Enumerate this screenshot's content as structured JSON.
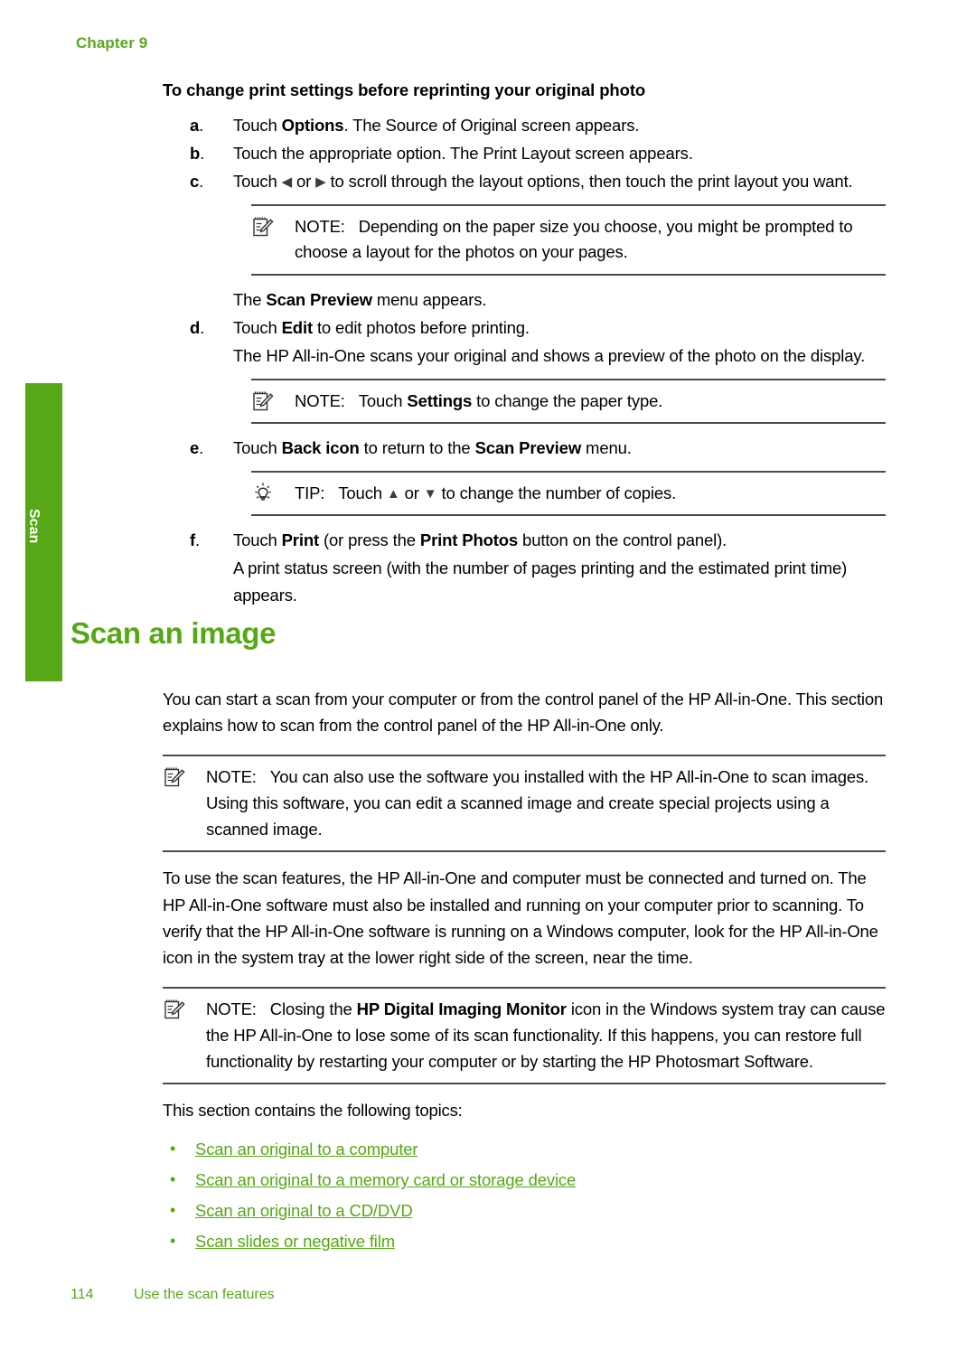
{
  "page": {
    "chapter_label": "Chapter 9",
    "side_tab_label": "Scan",
    "footer_page_number": "114",
    "footer_section": "Use the scan features",
    "accent_green": "#56a816",
    "link_green": "#56a816",
    "rule_color": "#4a4a4a"
  },
  "procedure": {
    "title": "To change print settings before reprinting your original photo",
    "steps": [
      {
        "marker": "a",
        "text_parts": [
          {
            "t": "Touch ",
            "bold": false
          },
          {
            "t": "Options",
            "bold": true
          },
          {
            "t": ". The Source of Original screen appears.",
            "bold": false
          }
        ]
      },
      {
        "marker": "b",
        "text_parts": [
          {
            "t": "Touch the appropriate option. The Print Layout screen appears.",
            "bold": false
          }
        ]
      },
      {
        "marker": "c",
        "text_parts": [
          {
            "t": "Touch ",
            "bold": false
          },
          {
            "t": "◀",
            "bold": false
          },
          {
            "t": " or ",
            "bold": false
          },
          {
            "t": "▶",
            "bold": false
          },
          {
            "t": " to scroll through the layout options, then touch the print layout you want.",
            "bold": false
          }
        ]
      },
      {
        "marker": "d",
        "text_parts": [
          {
            "t": "Touch ",
            "bold": false
          },
          {
            "t": "Edit",
            "bold": true
          },
          {
            "t": " to edit photos before printing.",
            "bold": false
          }
        ],
        "continuation": "The HP All-in-One scans your original and shows a preview of the photo on the display."
      },
      {
        "marker": "e",
        "text_parts": [
          {
            "t": "Touch ",
            "bold": false
          },
          {
            "t": "Back icon",
            "bold": true
          },
          {
            "t": " to return to the ",
            "bold": false
          },
          {
            "t": "Scan Preview",
            "bold": true
          },
          {
            "t": " menu.",
            "bold": false
          }
        ]
      },
      {
        "marker": "f",
        "text_parts": [
          {
            "t": "Touch ",
            "bold": false
          },
          {
            "t": "Print",
            "bold": true
          },
          {
            "t": " (or press the ",
            "bold": false
          },
          {
            "t": "Print Photos",
            "bold": true
          },
          {
            "t": " button on the control panel).",
            "bold": false
          }
        ],
        "continuation": "A print status screen (with the number of pages printing and the estimated print time) appears."
      }
    ],
    "note_layout": {
      "label": "NOTE:",
      "icon": "note-pad-pencil-icon",
      "text": "Depending on the paper size you choose, you might be prompted to choose a layout for the photos on your pages."
    },
    "after_note_line_parts": [
      {
        "t": "The ",
        "bold": false
      },
      {
        "t": "Scan Preview",
        "bold": true
      },
      {
        "t": " menu appears.",
        "bold": false
      }
    ],
    "note_settings": {
      "label": "NOTE:",
      "icon": "note-pad-pencil-icon",
      "text_parts": [
        {
          "t": "Touch ",
          "bold": false
        },
        {
          "t": "Settings",
          "bold": true
        },
        {
          "t": " to change the paper type.",
          "bold": false
        }
      ]
    },
    "tip_copies": {
      "label": "TIP:",
      "icon": "lightbulb-icon",
      "text_parts": [
        {
          "t": "Touch ",
          "bold": false
        },
        {
          "t": "▲",
          "bold": false
        },
        {
          "t": " or ",
          "bold": false
        },
        {
          "t": "▼",
          "bold": false
        },
        {
          "t": " to change the number of copies.",
          "bold": false
        }
      ]
    }
  },
  "section": {
    "heading": "Scan an image",
    "intro_paragraph": "You can start a scan from your computer or from the control panel of the HP All-in-One. This section explains how to scan from the control panel of the HP All-in-One only.",
    "note_software": {
      "label": "NOTE:",
      "icon": "note-pad-pencil-icon",
      "text": "You can also use the software you installed with the HP All-in-One to scan images. Using this software, you can edit a scanned image and create special projects using a scanned image."
    },
    "body_paragraph": "To use the scan features, the HP All-in-One and computer must be connected and turned on. The HP All-in-One software must also be installed and running on your computer prior to scanning. To verify that the HP All-in-One software is running on a Windows computer, look for the HP All-in-One icon in the system tray at the lower right side of the screen, near the time.",
    "note_monitor": {
      "label": "NOTE:",
      "icon": "note-pad-pencil-icon",
      "text_parts": [
        {
          "t": "Closing the ",
          "bold": false
        },
        {
          "t": "HP Digital Imaging Monitor",
          "bold": true
        },
        {
          "t": " icon in the Windows system tray can cause the HP All-in-One to lose some of its scan functionality. If this happens, you can restore full functionality by restarting your computer or by starting the HP Photosmart Software.",
          "bold": false
        }
      ]
    },
    "topics_intro": "This section contains the following topics:",
    "topics": [
      "Scan an original to a computer",
      "Scan an original to a memory card or storage device",
      "Scan an original to a CD/DVD",
      "Scan slides or negative film"
    ]
  }
}
